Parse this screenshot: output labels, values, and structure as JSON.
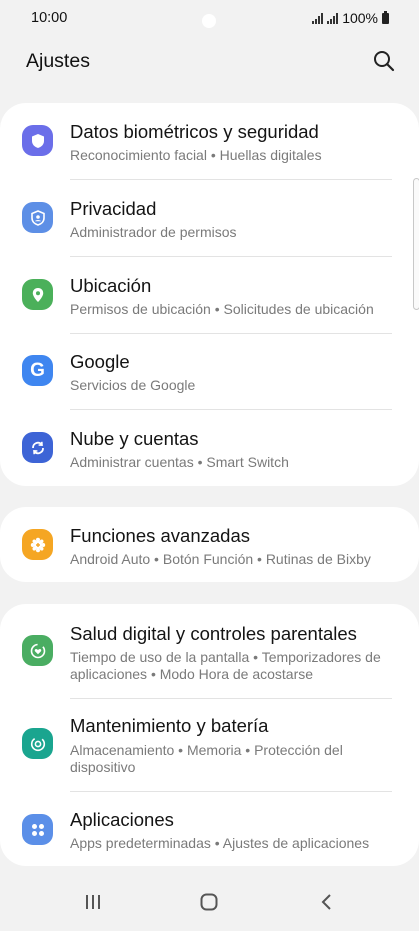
{
  "status": {
    "time": "10:00",
    "battery": "100%"
  },
  "header": {
    "title": "Ajustes",
    "search_icon": "search-icon"
  },
  "sections": [
    {
      "items": [
        {
          "title": "Datos biométricos y seguridad",
          "subtitle": "Reconocimiento facial  •  Huellas digitales",
          "icon": "shield-icon",
          "color": "#6b6ee9"
        },
        {
          "title": "Privacidad",
          "subtitle": "Administrador de permisos",
          "icon": "privacy-icon",
          "color": "#5d8fe6"
        },
        {
          "title": "Ubicación",
          "subtitle": "Permisos de ubicación  •  Solicitudes de ubicación",
          "icon": "location-pin-icon",
          "color": "#4bb05a"
        },
        {
          "title": "Google",
          "subtitle": "Servicios de Google",
          "icon": "google-icon",
          "color": "#3f86f0"
        },
        {
          "title": "Nube y cuentas",
          "subtitle": "Administrar cuentas  •  Smart Switch",
          "icon": "sync-icon",
          "color": "#3d64d6"
        }
      ]
    },
    {
      "items": [
        {
          "title": "Funciones avanzadas",
          "subtitle": "Android Auto  •  Botón Función  •  Rutinas de Bixby",
          "icon": "gear-plus-icon",
          "color": "#f5a623"
        }
      ]
    },
    {
      "items": [
        {
          "title": "Salud digital y controles parentales",
          "subtitle": "Tiempo de uso de la pantalla  •  Temporizadores de aplicaciones  •  Modo Hora de acostarse",
          "icon": "digital-wellbeing-icon",
          "color": "#4aad62"
        },
        {
          "title": "Mantenimiento y batería",
          "subtitle": "Almacenamiento  •  Memoria  •  Protección del dispositivo",
          "icon": "device-care-icon",
          "color": "#1aa58f"
        },
        {
          "title": "Aplicaciones",
          "subtitle": "Apps predeterminadas  •  Ajustes de aplicaciones",
          "icon": "apps-grid-icon",
          "color": "#5b8fe8"
        }
      ]
    }
  ],
  "navbar": {
    "recent": "recent-apps-icon",
    "home": "home-icon",
    "back": "back-icon"
  }
}
